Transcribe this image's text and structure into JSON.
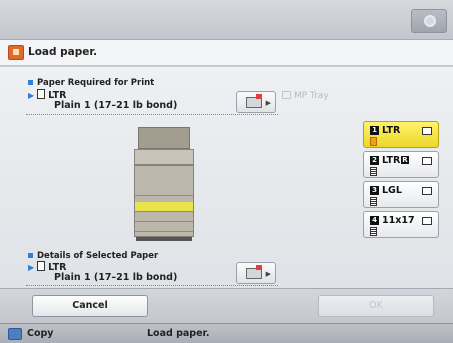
{
  "header": {
    "message": "Load paper."
  },
  "required": {
    "label": "Paper Required for Print",
    "size": "LTR",
    "type": "Plain 1 (17–21 lb bond)"
  },
  "mp_tray": {
    "label": "MP Tray"
  },
  "trays": [
    {
      "num": "1",
      "label": "LTR",
      "selected": true
    },
    {
      "num": "2",
      "label": "LTR",
      "suffix": "R"
    },
    {
      "num": "3",
      "label": "LGL"
    },
    {
      "num": "4",
      "label": "11x17"
    }
  ],
  "selected": {
    "label": "Details of Selected Paper",
    "size": "LTR",
    "type": "Plain 1 (17–21 lb bond)"
  },
  "buttons": {
    "cancel": "Cancel",
    "ok": "OK"
  },
  "status": {
    "app": "Copy",
    "message": "Load paper."
  },
  "icons": {
    "warning": "warning-icon",
    "settings": "gear-icon",
    "copy": "copy-icon",
    "tray_settings": "paper-settings-icon"
  },
  "colors": {
    "selected_tray": "#ecd72a",
    "accent": "#2f7fd6",
    "warning": "#e36a2d"
  }
}
